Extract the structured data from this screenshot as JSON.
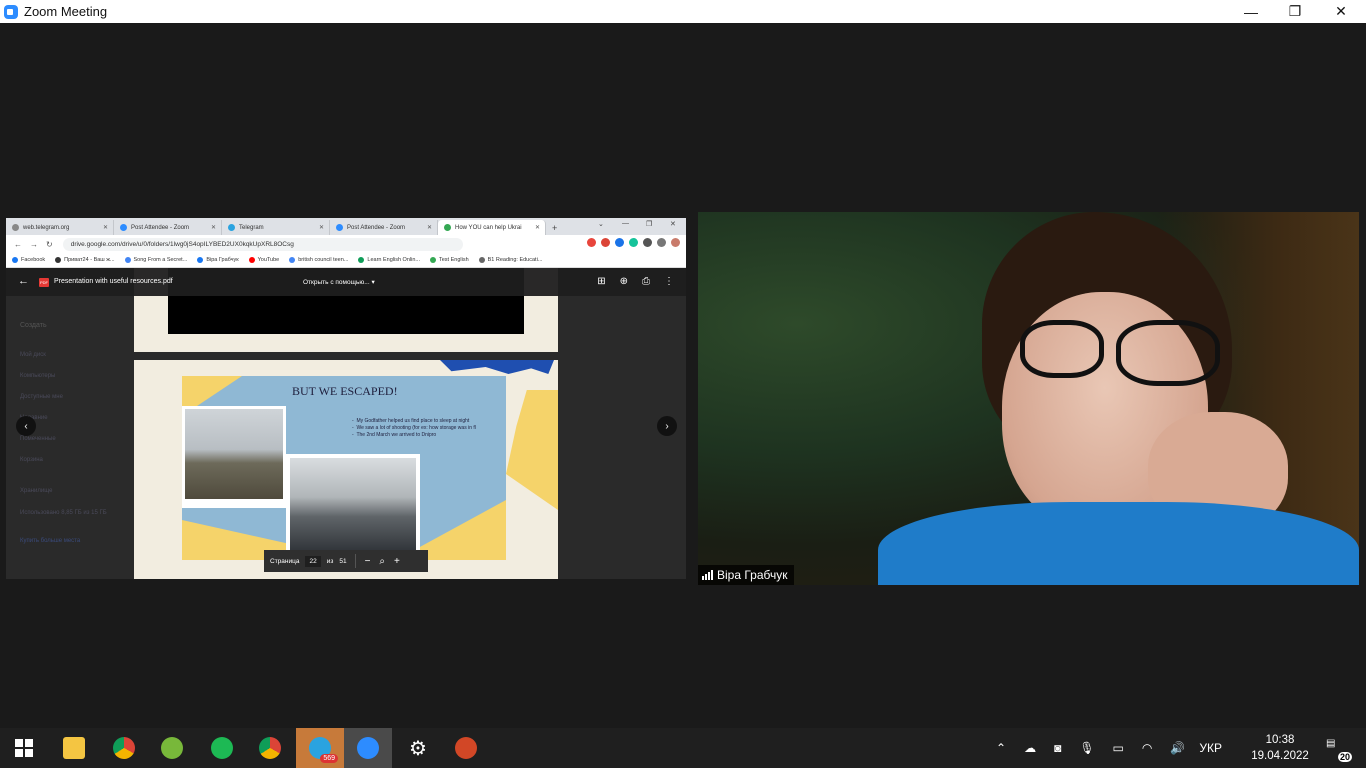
{
  "window": {
    "title": "Zoom Meeting",
    "controls": {
      "minimize": "—",
      "restore": "❐",
      "close": "✕"
    }
  },
  "browser": {
    "tabs": [
      {
        "label": "web.telegram.org",
        "color": "#888888",
        "active": false
      },
      {
        "label": "Post Attendee - Zoom",
        "color": "#2d8cff",
        "active": false
      },
      {
        "label": "Telegram",
        "color": "#2aa3e0",
        "active": false
      },
      {
        "label": "Post Attendee - Zoom",
        "color": "#2d8cff",
        "active": false
      },
      {
        "label": "How YOU can help Ukrai",
        "color": "#34a853",
        "active": true
      }
    ],
    "new_tab": "+",
    "url": "drive.google.com/drive/u/0/folders/1lwg0jS4opILYBED2UX0kqkUpXRL8OCsg",
    "bookmarks": [
      {
        "label": "Facebook",
        "color": "#1877f2"
      },
      {
        "label": "Приват24 - Ваш ж...",
        "color": "#333333"
      },
      {
        "label": "Song From a Secret...",
        "color": "#4285f4"
      },
      {
        "label": "Віра Грабчук",
        "color": "#1877f2"
      },
      {
        "label": "YouTube",
        "color": "#ff0000"
      },
      {
        "label": "british council teen...",
        "color": "#4285f4"
      },
      {
        "label": "Learn English Onlin...",
        "color": "#0f9d58"
      },
      {
        "label": "Test English",
        "color": "#34a853"
      },
      {
        "label": "B1 Reading: Educati...",
        "color": "#666666"
      }
    ]
  },
  "pdf": {
    "filename": "Presentation with useful resources.pdf",
    "open_with": "Открыть с помощью...",
    "slide_heading": "BUT WE ESCAPED!",
    "bullets": [
      "My Godfather helped us find place to sleep at night",
      "We saw a lot of shooting (for ex: how storage was in fl",
      "The 2nd March we arrived to Dnipro"
    ],
    "page_label": "Страница",
    "page_current": "22",
    "page_of": "из",
    "page_total": "51"
  },
  "drive_sidebar": [
    "Создать",
    "Мой диск",
    "Компьютеры",
    "Доступные мне",
    "Недавние",
    "Помеченные",
    "Корзина",
    "Хранилище",
    "Использовано 8,85 ГБ из 15 ГБ",
    "Купить больше места"
  ],
  "participant": {
    "name": "Віра Грабчук"
  },
  "taskbar": {
    "telegram_badge": "569",
    "language": "УКР",
    "time": "10:38",
    "date": "19.04.2022",
    "notifications": "20"
  }
}
